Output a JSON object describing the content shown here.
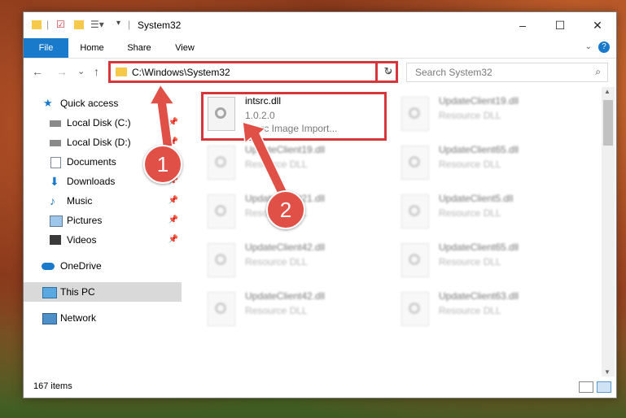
{
  "window": {
    "title": "System32",
    "controls": {
      "minimize": "–",
      "maximize": "☐",
      "close": "✕"
    }
  },
  "ribbon": {
    "tabs": [
      "File",
      "Home",
      "Share",
      "View"
    ],
    "help": "?"
  },
  "nav": {
    "back": "←",
    "forward": "→",
    "recent": "⌄",
    "up": "↑",
    "address": "C:\\Windows\\System32",
    "refresh": "↻",
    "search_placeholder": "Search System32"
  },
  "sidebar": {
    "items": [
      {
        "label": "Quick access",
        "icon": "star-icon"
      },
      {
        "label": "Local Disk (C:)",
        "icon": "drive-icon"
      },
      {
        "label": "Local Disk (D:)",
        "icon": "drive-icon"
      },
      {
        "label": "Documents",
        "icon": "documents-icon"
      },
      {
        "label": "Downloads",
        "icon": "download-icon"
      },
      {
        "label": "Music",
        "icon": "music-icon"
      },
      {
        "label": "Pictures",
        "icon": "pictures-icon"
      },
      {
        "label": "Videos",
        "icon": "videos-icon"
      },
      {
        "label": "OneDrive",
        "icon": "cloud-icon"
      },
      {
        "label": "This PC",
        "icon": "computer-icon"
      },
      {
        "label": "Network",
        "icon": "network-icon"
      }
    ]
  },
  "files": [
    {
      "name": "intsrc.dll",
      "sub": "1.0.2.0",
      "type": "Intsrc Image Import..."
    },
    {
      "name": "UpdateClient19.dll",
      "sub": "Resource DLL"
    },
    {
      "name": "UpdateClient19.dll",
      "sub": "Resource DLL"
    },
    {
      "name": "UpdateClient65.dll",
      "sub": "Resource DLL"
    },
    {
      "name": "UpdateClient21.dll",
      "sub": "Resource DLL"
    },
    {
      "name": "UpdateClient5.dll",
      "sub": "Resource DLL"
    },
    {
      "name": "UpdateClient42.dll",
      "sub": "Resource DLL"
    },
    {
      "name": "UpdateClient65.dll",
      "sub": "Resource DLL"
    },
    {
      "name": "UpdateClient42.dll",
      "sub": "Resource DLL"
    },
    {
      "name": "UpdateClient63.dll",
      "sub": "Resource DLL"
    }
  ],
  "status": {
    "count": "167 items"
  },
  "annotations": {
    "badge1": "1",
    "badge2": "2",
    "color": "#e05046"
  }
}
